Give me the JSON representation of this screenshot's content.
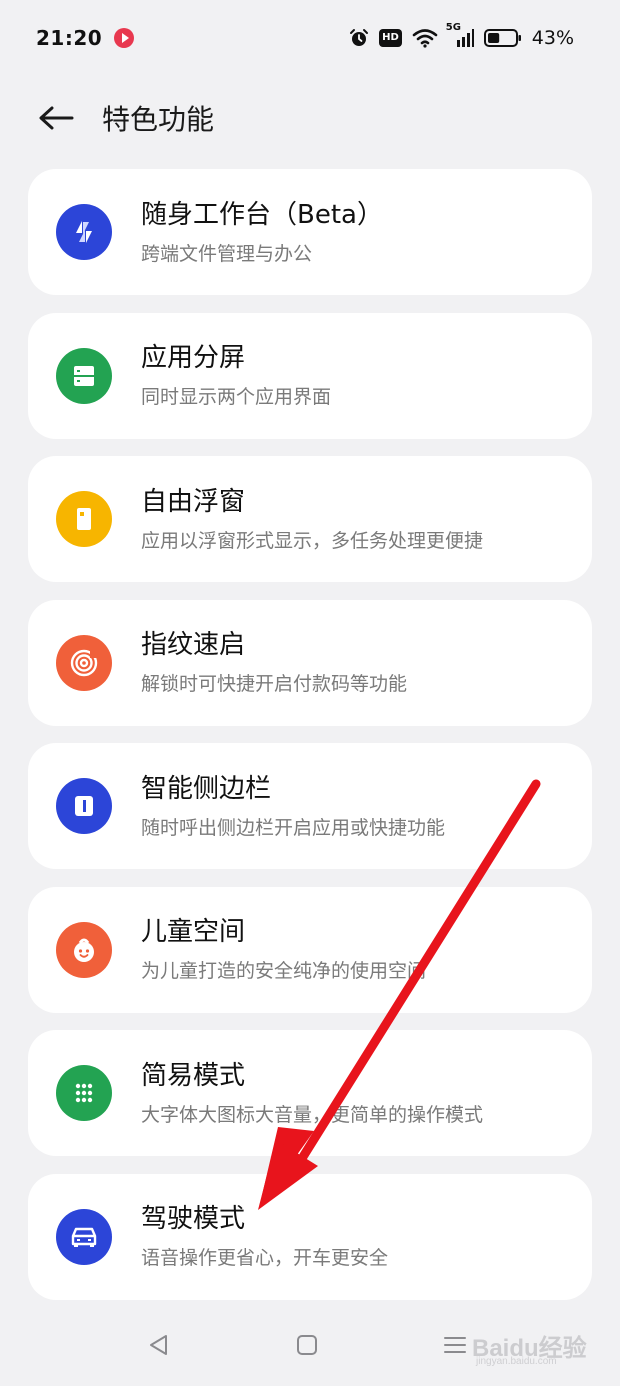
{
  "status_bar": {
    "time": "21:20",
    "hd_label": "HD",
    "network_label": "5G",
    "battery_percent": "43%",
    "battery_level": 0.43
  },
  "header": {
    "title": "特色功能"
  },
  "features": [
    {
      "title": "随身工作台（Beta）",
      "desc": "跨端文件管理与办公",
      "icon": "workbench-icon",
      "color": "#2c45d8"
    },
    {
      "title": "应用分屏",
      "desc": "同时显示两个应用界面",
      "icon": "split-screen-icon",
      "color": "#23a352"
    },
    {
      "title": "自由浮窗",
      "desc": "应用以浮窗形式显示，多任务处理更便捷",
      "icon": "floating-window-icon",
      "color": "#f7b500"
    },
    {
      "title": "指纹速启",
      "desc": "解锁时可快捷开启付款码等功能",
      "icon": "fingerprint-icon",
      "color": "#f0603a"
    },
    {
      "title": "智能侧边栏",
      "desc": "随时呼出侧边栏开启应用或快捷功能",
      "icon": "sidebar-icon",
      "color": "#2c45d8"
    },
    {
      "title": "儿童空间",
      "desc": "为儿童打造的安全纯净的使用空间",
      "icon": "kid-face-icon",
      "color": "#f0603a"
    },
    {
      "title": "简易模式",
      "desc": "大字体大图标大音量，更简单的操作模式",
      "icon": "grid-dots-icon",
      "color": "#23a352"
    },
    {
      "title": "驾驶模式",
      "desc": "语音操作更省心，开车更安全",
      "icon": "car-icon",
      "color": "#2c45d8"
    }
  ],
  "nav": {
    "back_icon": "triangle-back-icon",
    "home_icon": "square-home-icon",
    "recents_icon": "menu-lines-icon"
  },
  "watermark": {
    "text": "Baidu经验",
    "sub": "jingyan.baidu.com"
  },
  "annotation": {
    "arrow_color": "#e8141c"
  }
}
